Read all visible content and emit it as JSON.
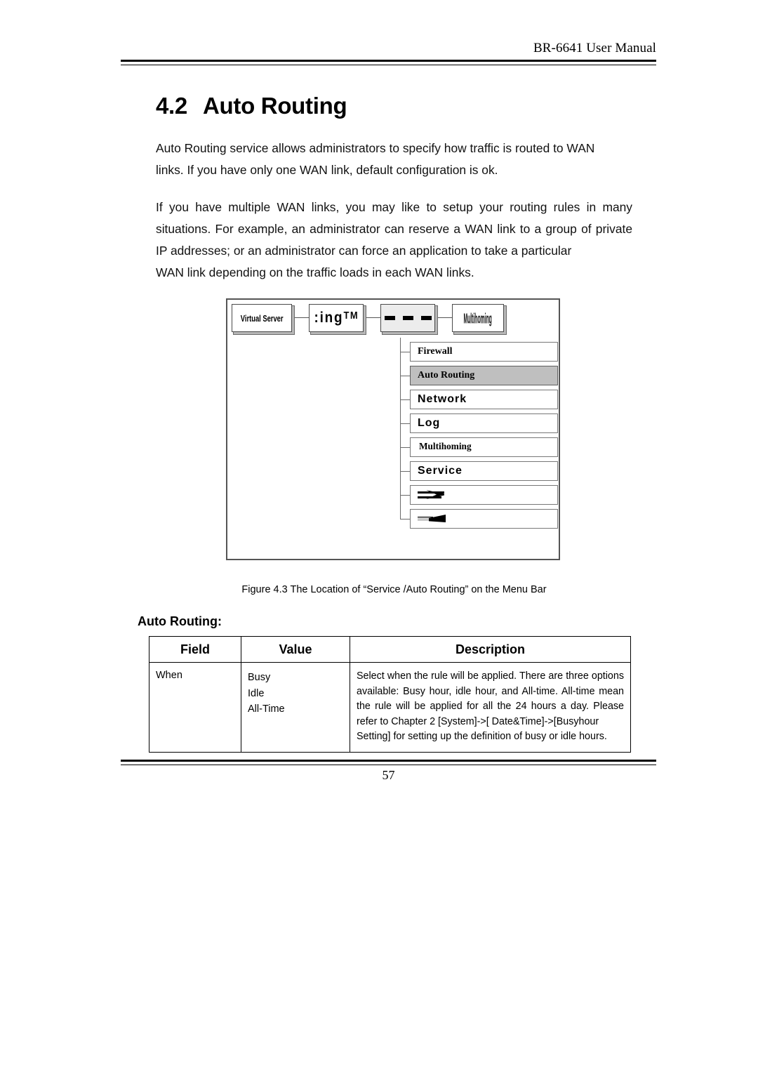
{
  "document": {
    "header_title": "BR-6641 User Manual",
    "page_number": "57"
  },
  "section": {
    "number": "4.2",
    "title": "Auto Routing"
  },
  "paragraphs": {
    "p1_main": "Auto Routing service allows administrators to specify how traffic is routed to WAN",
    "p1_last": "links. If you have only one WAN link, default configuration is ok.",
    "p2_main": "If you have multiple WAN links, you may like to setup your routing rules in many situations. For example, an administrator can reserve a WAN link to a group of private IP addresses; or an administrator can force an application to take a particular",
    "p2_last": "WAN link depending on the traffic loads in each WAN links."
  },
  "figure": {
    "caption": "Figure 4.3 The Location of “Service /Auto Routing” on the Menu Bar",
    "menubar": [
      {
        "label": "Virtual Server",
        "state": "normal"
      },
      {
        "label": ":ingᵀᴹ",
        "state": "normal"
      },
      {
        "label": "",
        "state": "active"
      },
      {
        "label": "Multihoming",
        "state": "normal"
      }
    ],
    "dropdown": [
      {
        "label": "Firewall",
        "selected": false
      },
      {
        "label": "Auto Routing",
        "selected": true
      },
      {
        "label": "Network",
        "selected": false
      },
      {
        "label": "Log",
        "selected": false
      },
      {
        "label": "Multihoming",
        "selected": false
      },
      {
        "label": "Service",
        "selected": false
      },
      {
        "label": "",
        "selected": false
      },
      {
        "label": "",
        "selected": false
      }
    ]
  },
  "table": {
    "label": "Auto Routing:",
    "headers": [
      "Field",
      "Value",
      "Description"
    ],
    "rows": [
      {
        "field": "When",
        "values": [
          "Busy",
          "Idle",
          "All-Time"
        ],
        "description_main": "Select when the rule will be applied. There are three options available: Busy hour, idle hour, and All-time. All-time mean the rule will be applied for all the 24 hours a day. Please refer to Chapter 2 [System]->[ Date&Time]->[Busyhour",
        "description_last": "Setting] for setting up the definition of busy or idle hours."
      }
    ]
  },
  "colors": {
    "ink": "#000000",
    "page": "#ffffff",
    "menu_highlight": "#bfbfbf",
    "menu_active": "#ececec"
  }
}
